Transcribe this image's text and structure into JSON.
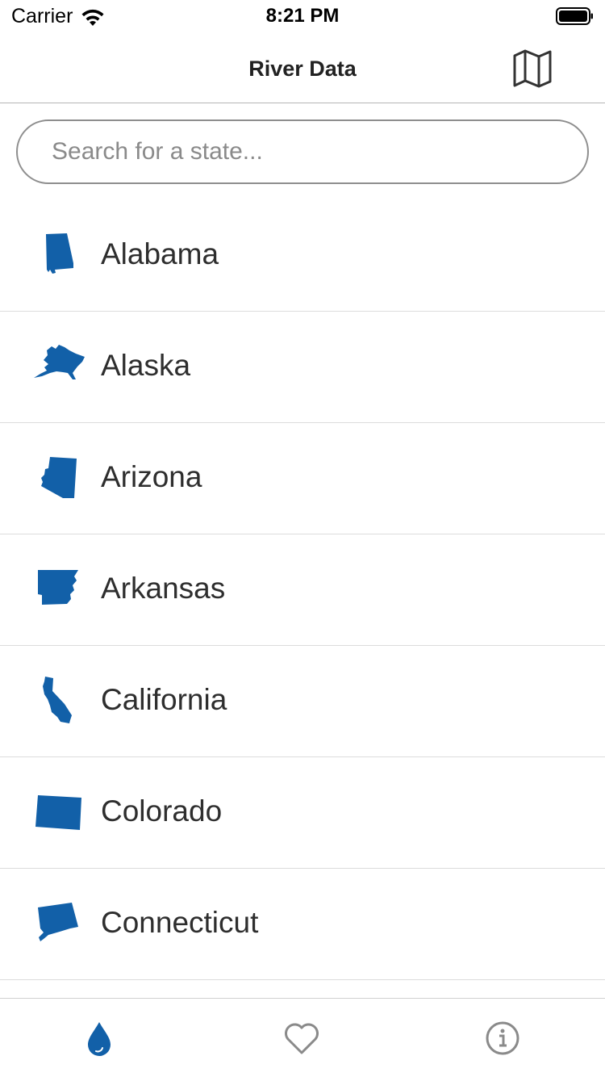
{
  "status_bar": {
    "carrier": "Carrier",
    "time": "8:21 PM"
  },
  "nav": {
    "title": "River Data",
    "map_icon": "map-icon"
  },
  "search": {
    "value": "",
    "placeholder": "Search for a state..."
  },
  "states": [
    {
      "name": "Alabama",
      "icon": "alabama-shape-icon"
    },
    {
      "name": "Alaska",
      "icon": "alaska-shape-icon"
    },
    {
      "name": "Arizona",
      "icon": "arizona-shape-icon"
    },
    {
      "name": "Arkansas",
      "icon": "arkansas-shape-icon"
    },
    {
      "name": "California",
      "icon": "california-shape-icon"
    },
    {
      "name": "Colorado",
      "icon": "colorado-shape-icon"
    },
    {
      "name": "Connecticut",
      "icon": "connecticut-shape-icon"
    }
  ],
  "tabs": [
    {
      "icon": "water-drop-icon",
      "selected": true
    },
    {
      "icon": "heart-icon",
      "selected": false
    },
    {
      "icon": "info-icon",
      "selected": false
    }
  ],
  "colors": {
    "accent": "#1260a8",
    "inactive": "#8a8a8a",
    "text": "#333333"
  }
}
